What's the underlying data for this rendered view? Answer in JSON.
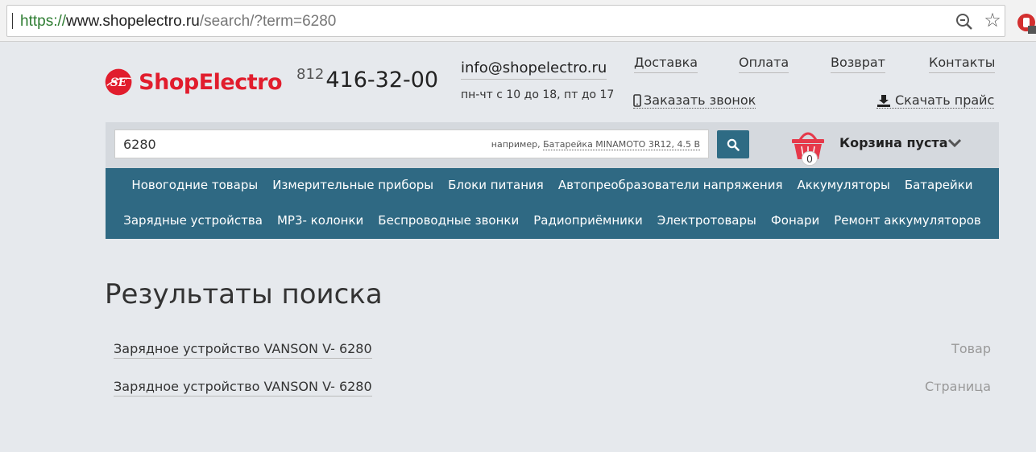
{
  "browser": {
    "url_scheme": "https://",
    "url_host": "www.shopelectro.ru",
    "url_path": "/search/?term=6280"
  },
  "header": {
    "logo_text": "ShopElectro",
    "logo_mark_text": "SE",
    "phone_code": "812",
    "phone_number": "416-32-00",
    "email": "info@shopelectro.ru",
    "hours": "пн-чт с 10 до 18, пт до 17",
    "nav": [
      {
        "label": "Доставка"
      },
      {
        "label": "Оплата"
      },
      {
        "label": "Возврат"
      },
      {
        "label": "Контакты"
      }
    ],
    "callback_label": "Заказать звонок",
    "download_label": "Скачать прайс"
  },
  "search": {
    "value": "6280",
    "example_prefix": "например,",
    "example_link": "Батарейка MINAMOTO 3R12, 4.5 В"
  },
  "cart": {
    "count": "0",
    "label": "Корзина пуста"
  },
  "categories": {
    "row1": [
      "Новогодние товары",
      "Измерительные приборы",
      "Блоки питания",
      "Автопреобразователи напряжения",
      "Аккумуляторы",
      "Батарейки"
    ],
    "row2": [
      "Зарядные устройства",
      "МР3- колонки",
      "Беспроводные звонки",
      "Радиоприёмники",
      "Электротовары",
      "Фонари",
      "Ремонт аккумуляторов"
    ]
  },
  "results": {
    "title": "Результаты поиска",
    "items": [
      {
        "name": "Зарядное устройство VANSON V- 6280",
        "type": "Товар"
      },
      {
        "name": "Зарядное устройство VANSON V- 6280",
        "type": "Страница"
      }
    ]
  },
  "colors": {
    "brand_red": "#e11d2d",
    "nav_blue": "#2f6983",
    "search_btn": "#2e6b84",
    "page_bg": "#e6e9ed"
  }
}
